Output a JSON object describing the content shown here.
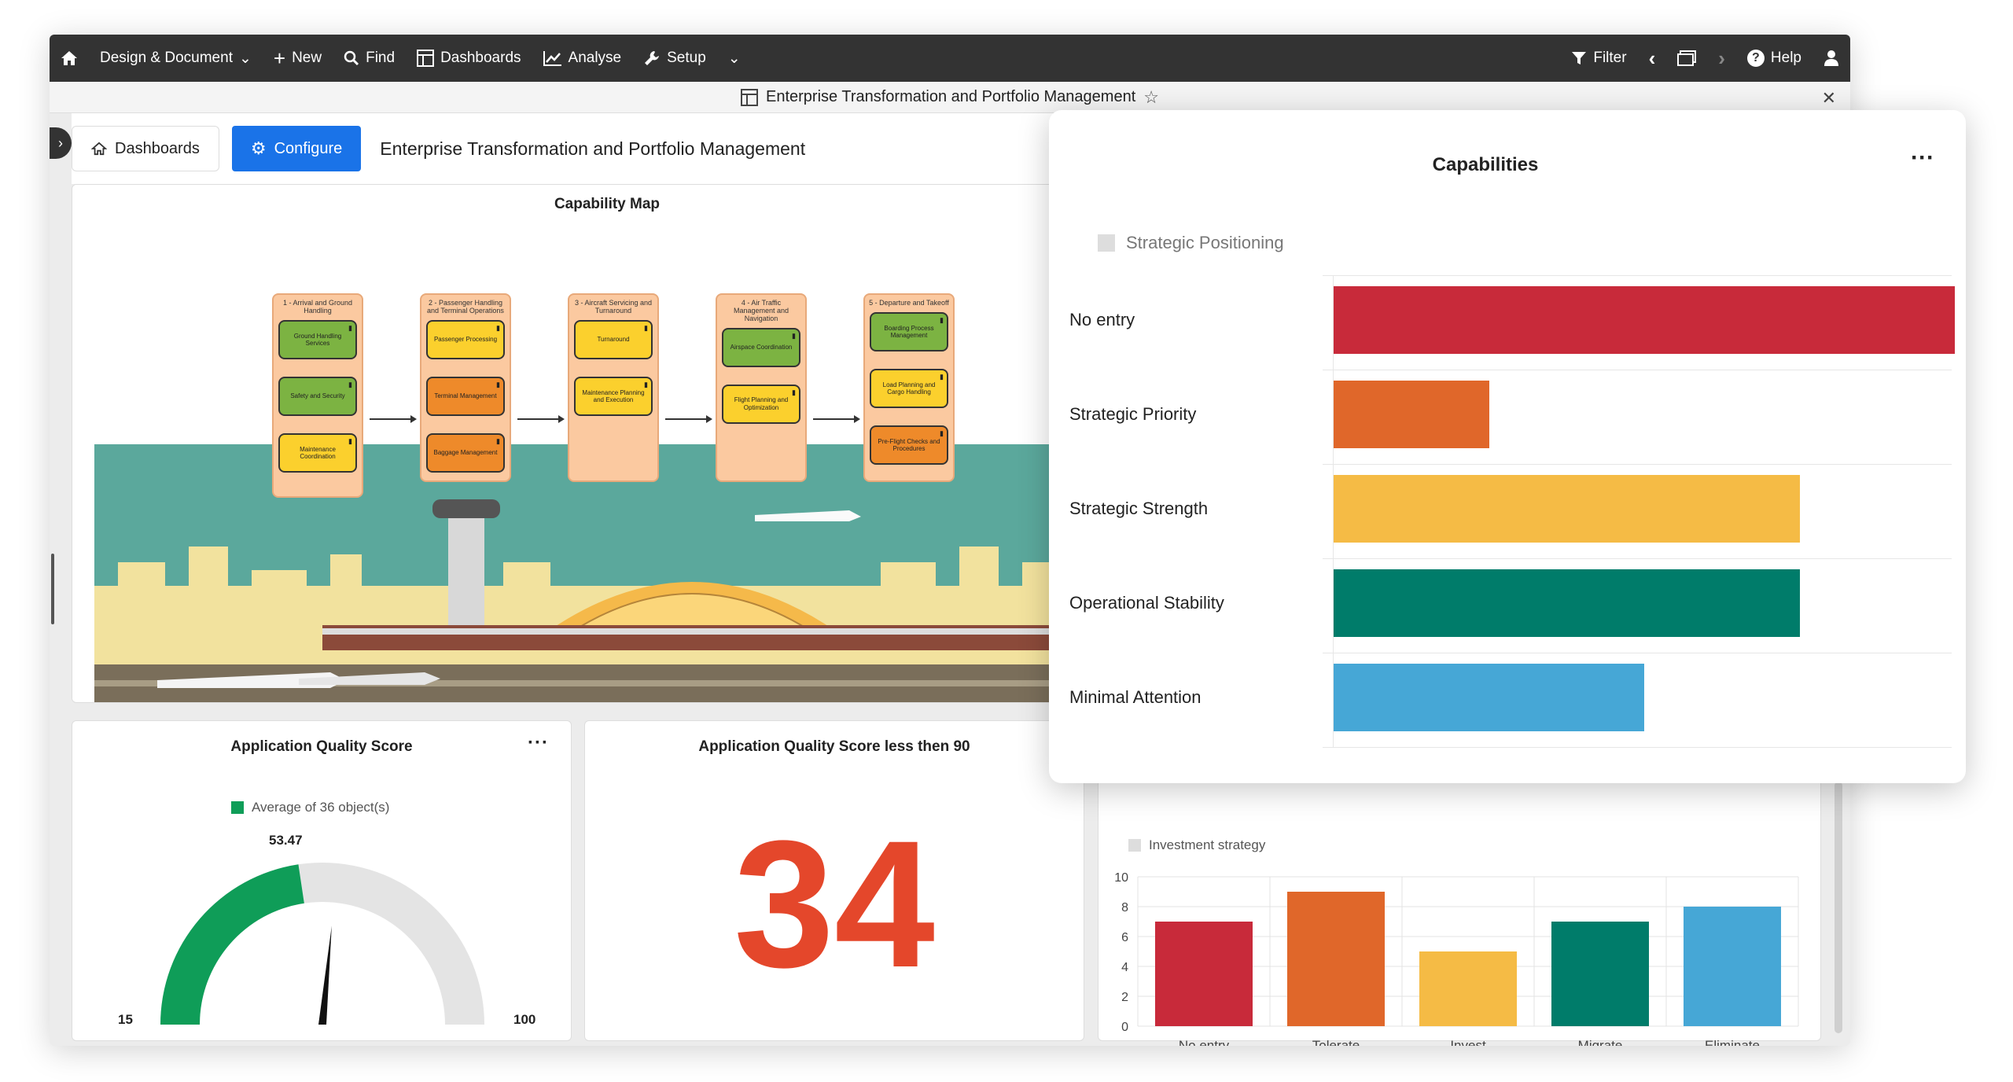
{
  "nav": {
    "design_label": "Design & Document",
    "new_label": "New",
    "find_label": "Find",
    "dashboards_label": "Dashboards",
    "analyse_label": "Analyse",
    "setup_label": "Setup",
    "filter_label": "Filter",
    "help_label": "Help"
  },
  "window": {
    "title": "Enterprise Transformation and Portfolio Management"
  },
  "toolbar": {
    "dashboards_btn": "Dashboards",
    "configure_btn": "Configure",
    "page_title": "Enterprise Transformation and Portfolio Management"
  },
  "capability_map": {
    "title": "Capability Map",
    "stages": [
      {
        "title": "1 - Arrival and Ground Handling",
        "caps": [
          {
            "label": "Ground Handling Services",
            "color": "#7cb342"
          },
          {
            "label": "Safety and Security",
            "color": "#7cb342"
          },
          {
            "label": "Maintenance Coordination",
            "color": "#fbd02d"
          }
        ]
      },
      {
        "title": "2 - Passenger Handling and Terminal Operations",
        "caps": [
          {
            "label": "Passenger Processing",
            "color": "#fbd02d"
          },
          {
            "label": "Terminal Management",
            "color": "#ee8a2a"
          },
          {
            "label": "Baggage Management",
            "color": "#ee8a2a"
          }
        ]
      },
      {
        "title": "3 - Aircraft Servicing and Turnaround",
        "caps": [
          {
            "label": "Turnaround",
            "color": "#fbd02d"
          },
          {
            "label": "Maintenance Planning and Execution",
            "color": "#fbd02d"
          }
        ]
      },
      {
        "title": "4 - Air Traffic Management and Navigation",
        "caps": [
          {
            "label": "Airspace Coordination",
            "color": "#7cb342"
          },
          {
            "label": "Flight Planning and Optimization",
            "color": "#fbd02d"
          }
        ]
      },
      {
        "title": "5 - Departure and Takeoff",
        "caps": [
          {
            "label": "Boarding Process Management",
            "color": "#7cb342"
          },
          {
            "label": "Load Planning and Cargo Handling",
            "color": "#fbd02d"
          },
          {
            "label": "Pre-Flight Checks and Procedures",
            "color": "#ee8a2a"
          }
        ]
      }
    ]
  },
  "quality_card": {
    "title": "Application Quality Score",
    "legend": "Average of 36 object(s)",
    "value_label": "53.47",
    "min_label": "15",
    "max_label": "100",
    "accent": "#0f9d58"
  },
  "chart_data": [
    {
      "type": "gauge",
      "title": "Application Quality Score",
      "series": [
        {
          "name": "Average of 36 object(s)",
          "values": [
            53.47
          ]
        }
      ],
      "ylim": [
        15,
        100
      ]
    },
    {
      "type": "bar",
      "title": "Capabilities",
      "orientation": "horizontal",
      "legend": "Strategic Positioning",
      "categories": [
        "No entry",
        "Strategic Priority",
        "Strategic Strength",
        "Operational Stability",
        "Minimal Attention"
      ],
      "values": [
        40,
        10,
        30,
        30,
        20
      ],
      "colors": [
        "#c82a3a",
        "#e0672a",
        "#f5bb45",
        "#007c6a",
        "#46a7d6"
      ]
    },
    {
      "type": "bar",
      "title": "",
      "legend": "Investment strategy",
      "categories": [
        "No entry",
        "Tolerate",
        "Invest",
        "Migrate",
        "Eliminate"
      ],
      "values": [
        7,
        9,
        5,
        7,
        8
      ],
      "ylim": [
        0,
        10
      ],
      "yticks": [
        "0",
        "2",
        "4",
        "6",
        "8",
        "10"
      ],
      "colors": [
        "#c82a3a",
        "#e0672a",
        "#f5bb45",
        "#007c6a",
        "#46a7d6"
      ]
    }
  ],
  "count_card": {
    "title": "Application Quality Score less then 90",
    "value": "34"
  },
  "investment_card": {
    "legend": "Investment strategy"
  },
  "capabilities_popup": {
    "title": "Capabilities",
    "legend": "Strategic Positioning"
  }
}
